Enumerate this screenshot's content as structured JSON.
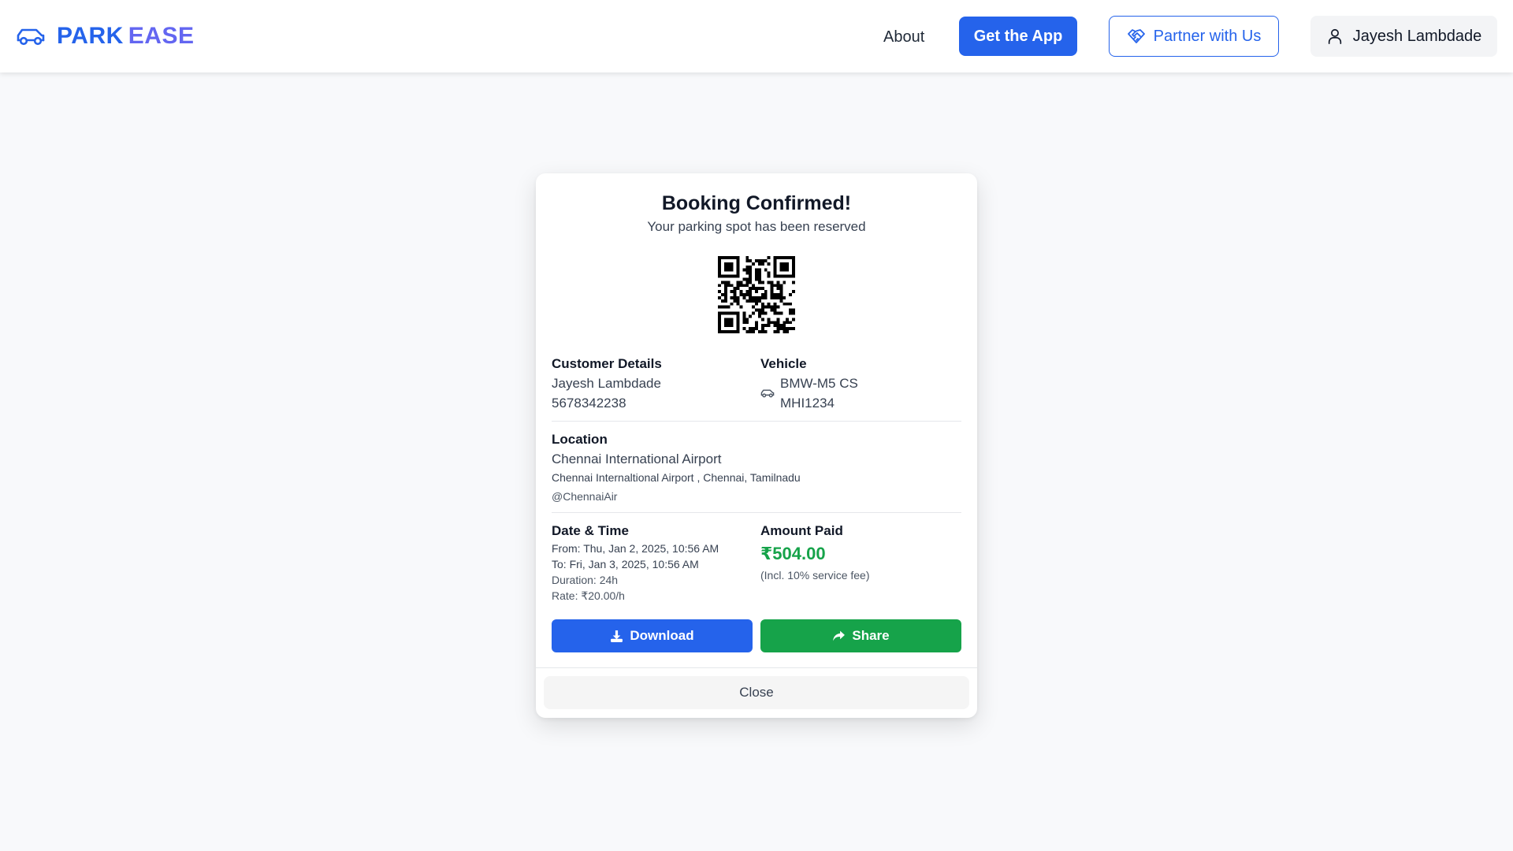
{
  "header": {
    "brand_part1": "PARK",
    "brand_part2": "EASE",
    "brand_icon": "car-icon",
    "nav_about": "About",
    "get_app_label": "Get the App",
    "partner_label": "Partner with Us",
    "partner_icon": "handshake-icon",
    "user_name": "Jayesh Lambdade",
    "user_icon": "user-icon"
  },
  "modal": {
    "title": "Booking Confirmed!",
    "subtitle": "Your parking spot has been reserved",
    "qr_icon": "qr-code",
    "customer": {
      "heading": "Customer Details",
      "name": "Jayesh Lambdade",
      "phone": "5678342238"
    },
    "vehicle": {
      "heading": "Vehicle",
      "model": "BMW-M5 CS",
      "plate": "MHI1234",
      "icon": "car-icon"
    },
    "location": {
      "heading": "Location",
      "name": "Chennai International Airport",
      "address": "Chennai Internaltional Airport , Chennai, Tamilnadu",
      "handle": "@ChennaiAir"
    },
    "datetime": {
      "heading": "Date & Time",
      "from": "From: Thu, Jan 2, 2025, 10:56 AM",
      "to": "To: Fri, Jan 3, 2025, 10:56 AM",
      "duration": "Duration: 24h",
      "rate": "Rate: ₹20.00/h"
    },
    "payment": {
      "heading": "Amount Paid",
      "amount": "₹504.00",
      "note": "(Incl. 10% service fee)"
    },
    "download_label": "Download",
    "download_icon": "download-icon",
    "share_label": "Share",
    "share_icon": "share-icon",
    "close_label": "Close"
  },
  "colors": {
    "primary": "#2563eb",
    "brand_secondary": "#6366f1",
    "success": "#16a34a",
    "background": "#f8f9fb"
  }
}
